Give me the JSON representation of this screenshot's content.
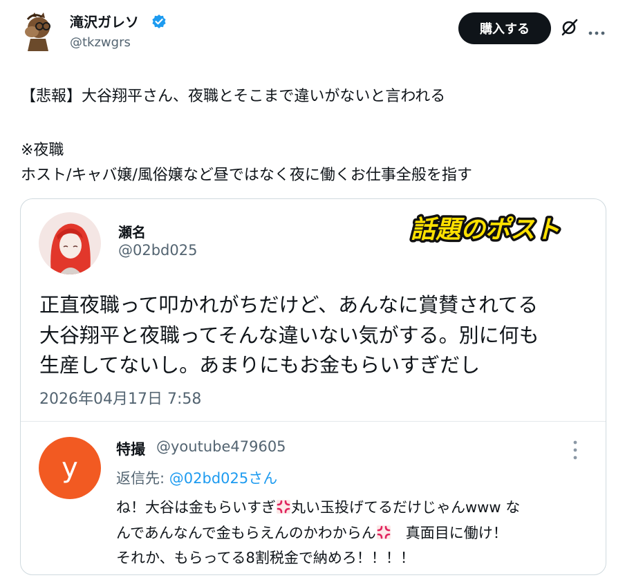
{
  "author": {
    "name": "滝沢ガレソ",
    "handle": "@tkzwgrs",
    "verified": true
  },
  "header": {
    "buy_label": "購入する"
  },
  "post": {
    "lines": [
      "【悲報】大谷翔平さん、夜職とそこまで違いがないと言われる",
      "※夜職",
      "ホスト/キャバ嬢/風俗嬢など昼ではなく夜に働くお仕事全般を指す"
    ]
  },
  "quote": {
    "badge": "話題のポスト",
    "name": "瀬名",
    "handle": "@02bd025",
    "lines": [
      "正直夜職って叩かれがちだけど、あんなに賞賛されてる",
      "大谷翔平と夜職ってそんな違いない気がする。別に何も",
      "生産してないし。あまりにもお金もらいすぎだし"
    ],
    "timestamp": "2026年04月17日 7:58"
  },
  "reply": {
    "avatar_letter": "y",
    "name": "特撮",
    "handle": "@youtube479605",
    "reply_to_prefix": "返信先: ",
    "reply_to_handle": "@02bd025さん",
    "line1_a": "ね！大谷は金もらいすぎ",
    "line1_b": "丸い玉投げてるだけじゃんwww な",
    "line2_a": "んであんなんで金もらえんのかわからん",
    "line2_b": "　真面目に働け！",
    "line3": "それか、もらってる8割税金で納めろ！！！！"
  },
  "colors": {
    "accent_blue": "#1d9bf0",
    "reply_avatar": "#f25a22",
    "badge_yellow": "#ffe100",
    "secondary_text": "#536471"
  },
  "icons": {
    "verified": "verified-badge-icon",
    "grok": "grok-icon",
    "more": "more-horizontal-icon",
    "kebab": "more-vertical-icon",
    "anger": "anger-symbol-icon"
  }
}
